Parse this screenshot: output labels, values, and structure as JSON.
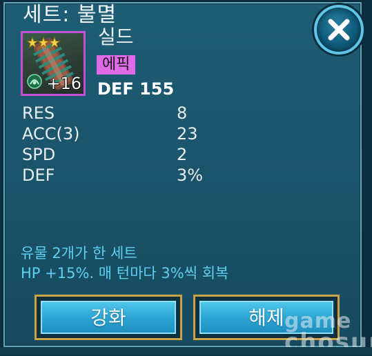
{
  "dialog": {
    "title": "세트: 불멸",
    "close_icon": "close-icon"
  },
  "item": {
    "name": "실드",
    "rarity": "에픽",
    "rarity_color": "#e06be9",
    "main_stat": "DEF 155",
    "level": "+16",
    "stars": 3,
    "frame_color": "#c34fd6",
    "icon": "shield-gauntlet-icon"
  },
  "substats": [
    {
      "label": "RES",
      "value": "8"
    },
    {
      "label": "ACC(3)",
      "value": "23"
    },
    {
      "label": "SPD",
      "value": "2"
    },
    {
      "label": "DEF",
      "value": "3%"
    }
  ],
  "set_bonus": {
    "line1": "유물 2개가 한 세트",
    "line2": "HP +15%. 매 턴마다 3%씩 회복"
  },
  "buttons": {
    "enhance": "강화",
    "unequip": "해제"
  },
  "watermark": {
    "line1": "game",
    "line2": "chosun"
  }
}
